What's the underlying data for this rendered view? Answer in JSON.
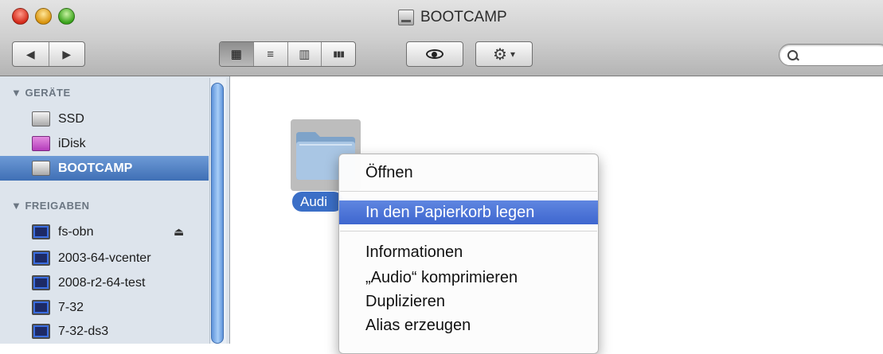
{
  "window": {
    "title": "BOOTCAMP"
  },
  "toolbar": {
    "back_glyph": "◀",
    "forward_glyph": "▶",
    "view_icon_glyph": "▦",
    "view_list_glyph": "≡",
    "view_column_glyph": "▥",
    "view_coverflow_glyph": "▮▮▮",
    "quicklook_glyph": "👁",
    "action_glyph": "⚙",
    "action_arrow": "▾",
    "search_glyph": "🔍",
    "search_placeholder": ""
  },
  "sidebar": {
    "devices_header": "▼ GERÄTE",
    "devices": [
      {
        "label": "SSD",
        "icon": "hard-drive-icon"
      },
      {
        "label": "iDisk",
        "icon": "idisk-icon"
      },
      {
        "label": "BOOTCAMP",
        "icon": "hard-drive-icon",
        "selected": true
      }
    ],
    "shares_header": "▼ FREIGABEN",
    "shares": [
      {
        "label": "fs-obn",
        "icon": "network-monitor-icon",
        "eject": "⏏"
      },
      {
        "label": "2003-64-vcenter",
        "icon": "network-monitor-icon"
      },
      {
        "label": "2008-r2-64-test",
        "icon": "network-monitor-icon"
      },
      {
        "label": "7-32",
        "icon": "network-monitor-icon"
      },
      {
        "label": "7-32-ds3",
        "icon": "network-monitor-icon"
      }
    ]
  },
  "content": {
    "items": [
      {
        "label": "Audi",
        "icon": "folder-icon",
        "selected": true
      }
    ]
  },
  "context_menu": {
    "items": [
      {
        "label": "Öffnen"
      },
      {
        "label": "In den Papierkorb legen",
        "highlighted": true
      },
      {
        "label": "Informationen"
      },
      {
        "label": "„Audio“ komprimieren"
      },
      {
        "label": "Duplizieren"
      },
      {
        "label": "Alias erzeugen"
      }
    ]
  },
  "colors": {
    "selection_blue": "#3f6fb5",
    "menu_highlight": "#3e66cf",
    "sidebar_bg": "#dde4ec"
  }
}
